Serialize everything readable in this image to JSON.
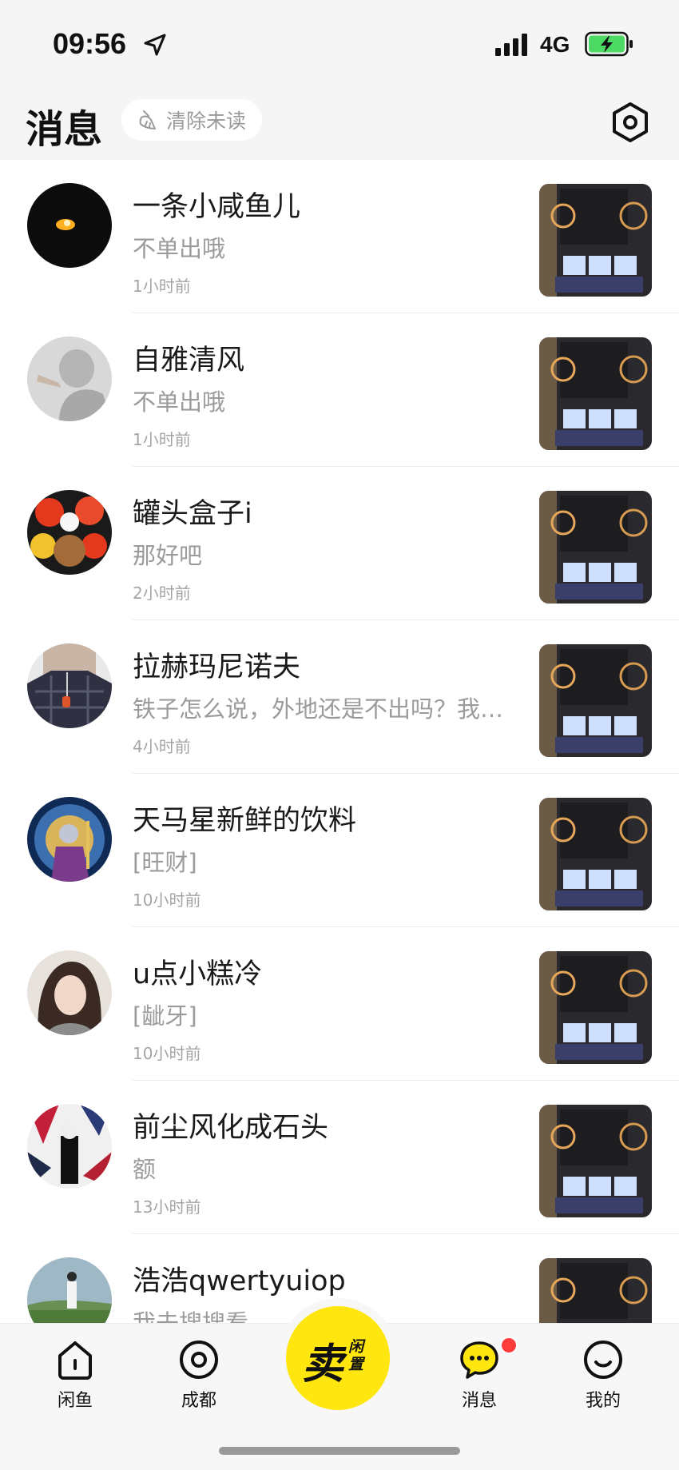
{
  "status_bar": {
    "time": "09:56",
    "network": "4G"
  },
  "header": {
    "title": "消息",
    "clear_unread": "清除未读"
  },
  "messages": [
    {
      "name": "一条小咸鱼儿",
      "preview": "不单出哦",
      "time": "1小时前"
    },
    {
      "name": "自雅清风",
      "preview": "不单出哦",
      "time": "1小时前"
    },
    {
      "name": "罐头盒子i",
      "preview": "那好吧",
      "time": "2小时前"
    },
    {
      "name": "拉赫玛尼诺夫",
      "preview": "铁子怎么说，外地还是不出吗？我…",
      "time": "4小时前"
    },
    {
      "name": "天马星新鲜的饮料",
      "preview": "[旺财]",
      "time": "10小时前"
    },
    {
      "name": "u点小糕冷",
      "preview": "[龇牙]",
      "time": "10小时前"
    },
    {
      "name": "前尘风化成石头",
      "preview": "额",
      "time": "13小时前"
    },
    {
      "name": "浩浩qwertyuiop",
      "preview": "我去搜搜看",
      "time": ""
    }
  ],
  "tab_bar": {
    "home": "闲鱼",
    "city": "成都",
    "sell": "卖",
    "sell_sub": "闲置",
    "messages": "消息",
    "mine": "我的"
  },
  "colors": {
    "accent": "#ffe60f",
    "badge": "#ff3b3b",
    "battery": "#4cd964"
  }
}
